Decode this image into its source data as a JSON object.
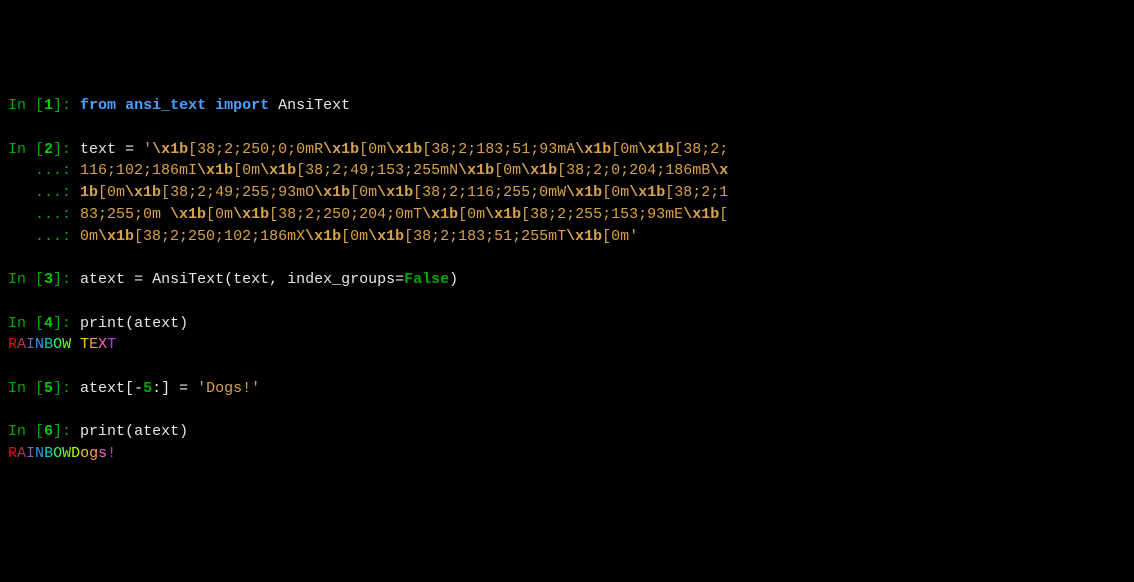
{
  "prompt": {
    "in": "In [",
    "close": "]: ",
    "cont": "   ...: "
  },
  "cells": {
    "1": {
      "n": "1",
      "kw_from": "from",
      "mod": "ansi_text",
      "kw_import": "import",
      "cls": "AnsiText"
    },
    "2": {
      "n": "2",
      "lhs": "text ",
      "eq": "=",
      "sp": " ",
      "q": "'",
      "e": "\\x1b",
      "segs": {
        "l1a": "[38;2;250;0;0mR",
        "l1b": "[0m",
        "l1c": "[38;2;183;51;93mA",
        "l1d": "[0m",
        "l1e": "[38;2;",
        "l2a": "116;102;186mI",
        "l2b": "[0m",
        "l2c": "[38;2;49;153;255mN",
        "l2d": "[0m",
        "l2e": "[38;2;0;204;186mB",
        "l3a": "1b",
        "l3b": "[0m",
        "l3c": "[38;2;49;255;93mO",
        "l3d": "[0m",
        "l3e": "[38;2;116;255;0mW",
        "l3f": "[0m",
        "l3g": "[38;2;1",
        "l4a": "83;255;0m ",
        "l4b": "[0m",
        "l4c": "[38;2;250;204;0mT",
        "l4d": "[0m",
        "l4e": "[38;2;255;153;93mE",
        "l4f": "[",
        "l5a": "0m",
        "l5b": "[38;2;250;102;186mX",
        "l5c": "[0m",
        "l5d": "[38;2;183;51;255mT",
        "l5e": "[0m"
      }
    },
    "3": {
      "n": "3",
      "lhs": "atext ",
      "eq": "=",
      "sp": " ",
      "call": "AnsiText(text, index_groups",
      "eq2": "=",
      "false": "False",
      "close": ")"
    },
    "4": {
      "n": "4",
      "call": "print",
      "arg": "(atext)"
    },
    "5": {
      "n": "5",
      "lhs": "atext[",
      "op": "-",
      "num": "5",
      "rest": ":] ",
      "eq": "=",
      "sp": " ",
      "str": "'Dogs!'"
    },
    "6": {
      "n": "6",
      "call": "print",
      "arg": "(atext)"
    }
  },
  "output": {
    "rainbow": {
      "R": "R",
      "A": "A",
      "I": "I",
      "N": "N",
      "B": "B",
      "O": "O",
      "W": "W",
      "sp": " ",
      "T": "T",
      "E": "E",
      "X": "X",
      "T2": "T"
    },
    "dogs": {
      "d": "D",
      "o": "o",
      "g": "g",
      "s": "s",
      "bang": "!"
    }
  },
  "colors": {
    "R": "rgb(250,0,0)",
    "A": "rgb(183,51,93)",
    "I": "rgb(116,102,186)",
    "N": "rgb(49,153,255)",
    "B": "rgb(0,204,186)",
    "O": "rgb(49,255,93)",
    "W": "rgb(116,255,0)",
    "sp": "rgb(183,255,0)",
    "T": "rgb(250,204,0)",
    "E": "rgb(255,153,93)",
    "X": "rgb(250,102,186)",
    "T2": "rgb(183,51,255)"
  }
}
